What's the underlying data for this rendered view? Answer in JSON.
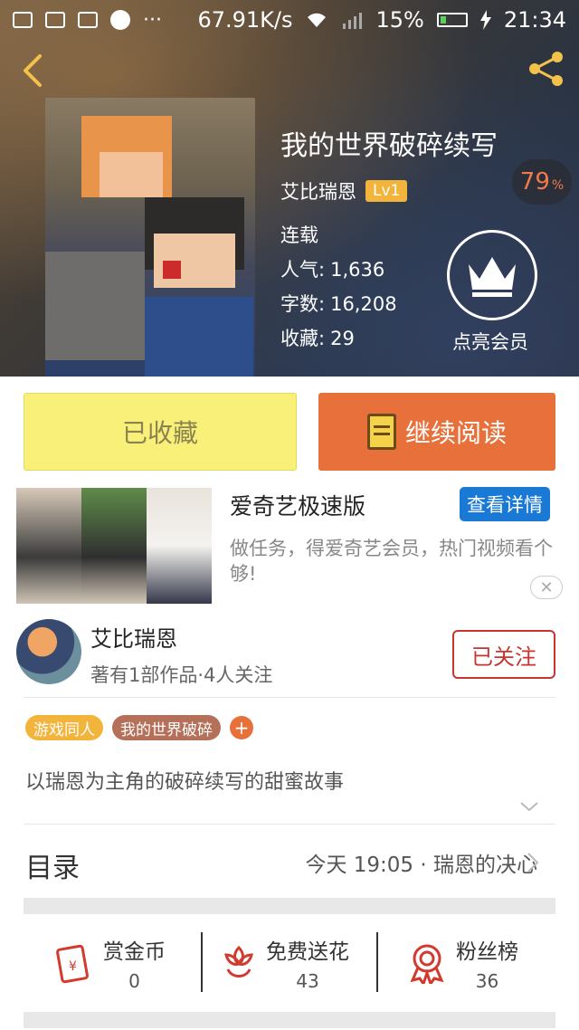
{
  "statusbar": {
    "speed": "67.91K/s",
    "battery": "15%",
    "time": "21:34",
    "more": "···"
  },
  "book": {
    "title": "我的世界破碎续写",
    "author": "艾比瑞恩",
    "level": "Lv1",
    "rating": "79",
    "rating_unit": "%",
    "status": "连载",
    "popularity_label": "人气:",
    "popularity": "1,636",
    "words_label": "字数:",
    "words": "16,208",
    "favorites_label": "收藏:",
    "favorites": "29",
    "vip_label": "点亮会员"
  },
  "actions": {
    "collected_label": "已收藏",
    "continue_label": "继续阅读"
  },
  "ad": {
    "title": "爱奇艺极速版",
    "button": "查看详情",
    "description": "做任务，得爱奇艺会员，热门视频看个够!",
    "close": "✕"
  },
  "author_card": {
    "name": "艾比瑞恩",
    "subtitle": "著有1部作品·4人关注",
    "follow_label": "已关注"
  },
  "tags": [
    "游戏同人",
    "我的世界破碎"
  ],
  "tag_add": "+",
  "intro": "以瑞恩为主角的破碎续写的甜蜜故事",
  "toc": {
    "label": "目录",
    "latest": "今天 19:05 · 瑞恩的决心"
  },
  "stats": [
    {
      "label": "赏金币",
      "value": "0"
    },
    {
      "label": "免费送花",
      "value": "43"
    },
    {
      "label": "粉丝榜",
      "value": "36"
    }
  ],
  "colors": {
    "accent_orange": "#e8703b",
    "collect_yellow": "#f9f07a",
    "follow_red": "#c8352f",
    "ad_blue": "#1b79d6",
    "level_gold": "#f3b43b"
  }
}
